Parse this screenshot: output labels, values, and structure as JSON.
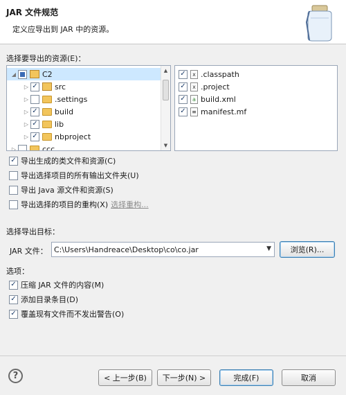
{
  "banner": {
    "title": "JAR 文件规范",
    "description": "定义应导出到 JAR 中的资源。"
  },
  "resources_label": "选择要导出的资源(E)：",
  "tree": {
    "root": {
      "label": "C2"
    },
    "children": [
      {
        "label": "src",
        "checked": true
      },
      {
        "label": ".settings",
        "checked": false
      },
      {
        "label": "build",
        "checked": true
      },
      {
        "label": "lib",
        "checked": true
      },
      {
        "label": "nbproject",
        "checked": true
      }
    ],
    "partial_next": "ccc"
  },
  "files": [
    {
      "label": ".classpath",
      "icon_text": "x"
    },
    {
      "label": ".project",
      "icon_text": "x"
    },
    {
      "label": "build.xml",
      "icon_text": "a"
    },
    {
      "label": "manifest.mf",
      "icon_text": "≡"
    }
  ],
  "options": {
    "export_class_files": "导出生成的类文件和资源(C)",
    "export_output_folders": "导出选择项目的所有输出文件夹(U)",
    "export_java_source": "导出 Java 源文件和资源(S)",
    "export_refactorings": "导出选择的项目的重构(X)",
    "select_refactorings_link": "选择重构..."
  },
  "destination": {
    "section_label": "选择导出目标：",
    "jar_file_label": "JAR 文件：",
    "jar_path": "C:\\Users\\Handreace\\Desktop\\co\\co.jar",
    "browse_label": "浏览(R)..."
  },
  "options_section": {
    "label": "选项：",
    "compress": "压缩 JAR 文件的内容(M)",
    "add_dir_entries": "添加目录条目(D)",
    "overwrite": "覆盖现有文件而不发出警告(O)"
  },
  "footer": {
    "help_text": "?",
    "back": "< 上一步(B)",
    "next": "下一步(N) >",
    "finish": "完成(F)",
    "cancel": "取消"
  }
}
